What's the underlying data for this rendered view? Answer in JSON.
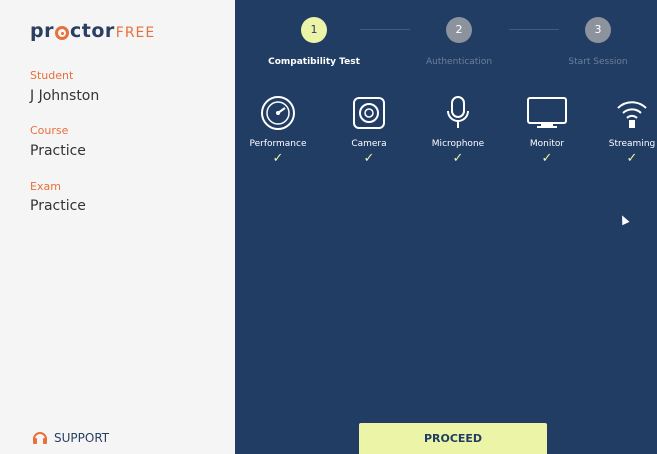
{
  "brand": {
    "main": "pr",
    "after_o": "ctor",
    "free": "FREE"
  },
  "sidebar": {
    "student_label": "Student",
    "student_value": "J Johnston",
    "course_label": "Course",
    "course_value": "Practice",
    "exam_label": "Exam",
    "exam_value": "Practice",
    "support_label": "SUPPORT"
  },
  "steps": [
    {
      "number": "1",
      "label": "Compatibility Test",
      "active": true
    },
    {
      "number": "2",
      "label": "Authentication",
      "active": false
    },
    {
      "number": "3",
      "label": "Start Session",
      "active": false
    }
  ],
  "checks": [
    {
      "label": "Performance",
      "icon": "speedometer-icon",
      "status": "✓"
    },
    {
      "label": "Camera",
      "icon": "camera-icon",
      "status": "✓"
    },
    {
      "label": "Microphone",
      "icon": "microphone-icon",
      "status": "✓"
    },
    {
      "label": "Monitor",
      "icon": "monitor-icon",
      "status": "✓"
    },
    {
      "label": "Streaming",
      "icon": "wifi-icon",
      "status": "✓"
    }
  ],
  "proceed_label": "PROCEED",
  "colors": {
    "navy": "#213d63",
    "accent": "#ecf5a7",
    "orange": "#e8703a",
    "sidebar": "#f5f5f5"
  }
}
